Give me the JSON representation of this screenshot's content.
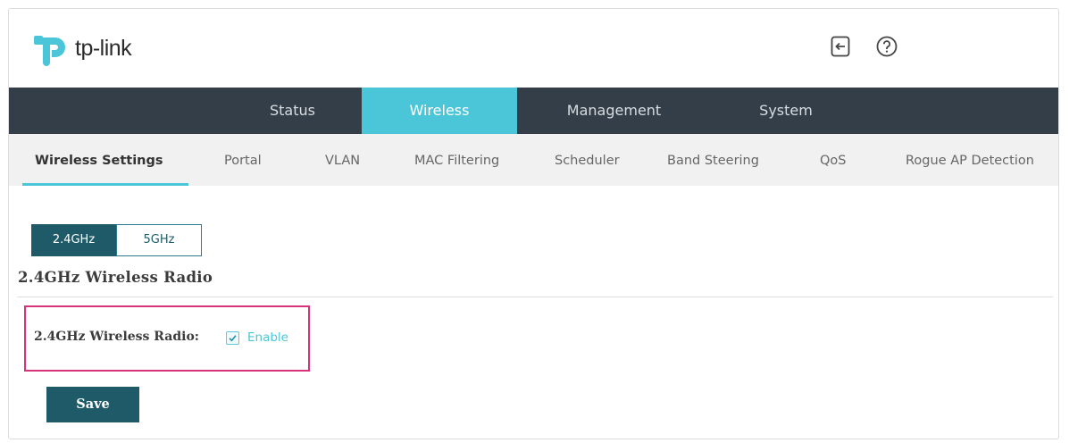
{
  "brand": {
    "logo_text": "tp-link",
    "color": "#4bc6d8"
  },
  "header": {
    "icons": [
      "logout-icon",
      "help-icon"
    ]
  },
  "main_nav": {
    "tabs": [
      {
        "label": "Status",
        "active": false
      },
      {
        "label": "Wireless",
        "active": true
      },
      {
        "label": "Management",
        "active": false
      },
      {
        "label": "System",
        "active": false
      }
    ]
  },
  "sub_nav": {
    "items": [
      {
        "label": "Wireless Settings",
        "active": true
      },
      {
        "label": "Portal",
        "active": false
      },
      {
        "label": "VLAN",
        "active": false
      },
      {
        "label": "MAC Filtering",
        "active": false
      },
      {
        "label": "Scheduler",
        "active": false
      },
      {
        "label": "Band Steering",
        "active": false
      },
      {
        "label": "QoS",
        "active": false
      },
      {
        "label": "Rogue AP Detection",
        "active": false
      }
    ]
  },
  "band_toggle": {
    "options": [
      "2.4GHz",
      "5GHz"
    ],
    "selected": "2.4GHz"
  },
  "section": {
    "title": "2.4GHz Wireless Radio"
  },
  "form": {
    "radio_label": "2.4GHz Wireless Radio:",
    "enable_label": "Enable",
    "enable_checked": true
  },
  "actions": {
    "save_label": "Save"
  },
  "colors": {
    "nav_bg": "#333e48",
    "accent": "#4bc6d8",
    "primary": "#1f5a68",
    "highlight": "#d6337b"
  }
}
